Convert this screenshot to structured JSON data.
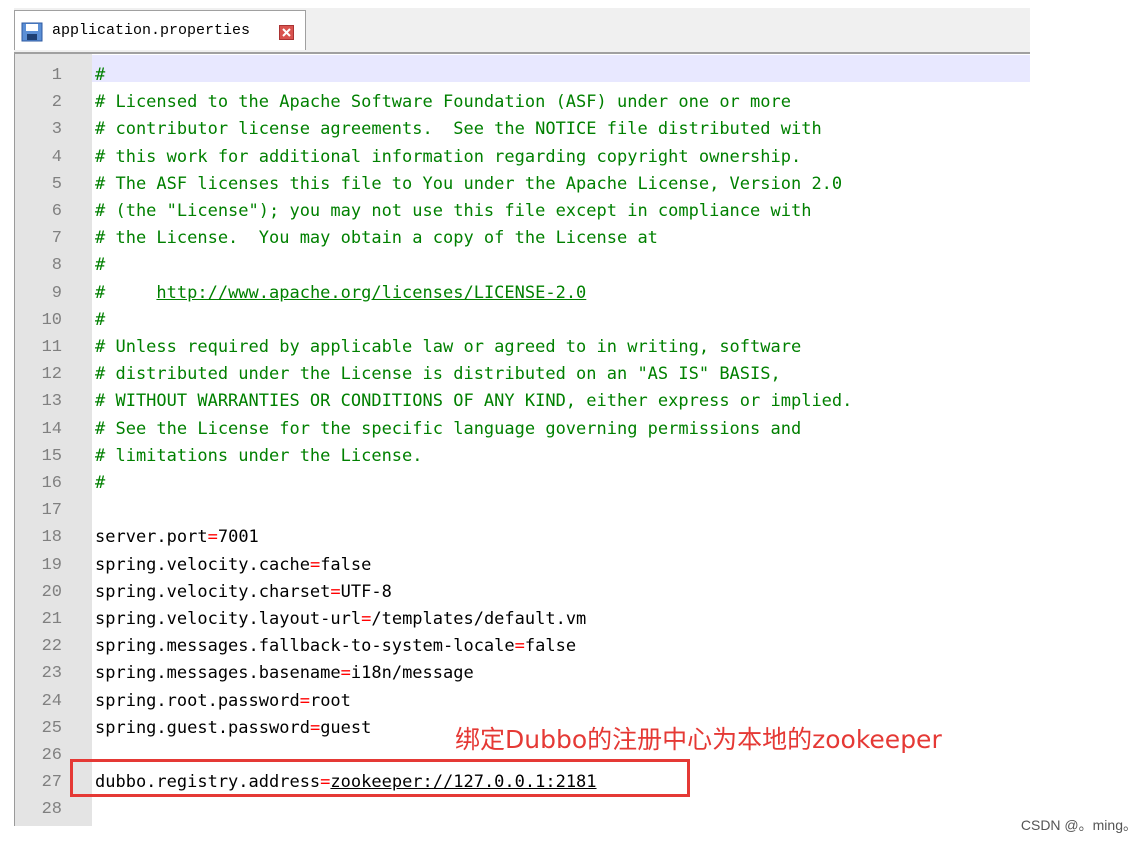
{
  "tab": {
    "filename": "application.properties",
    "icon": "file-save-icon",
    "close_icon": "close-icon"
  },
  "lines": [
    {
      "n": "1",
      "kind": "comment",
      "text": "#"
    },
    {
      "n": "2",
      "kind": "comment",
      "text": "# Licensed to the Apache Software Foundation (ASF) under one or more"
    },
    {
      "n": "3",
      "kind": "comment",
      "text": "# contributor license agreements.  See the NOTICE file distributed with"
    },
    {
      "n": "4",
      "kind": "comment",
      "text": "# this work for additional information regarding copyright ownership."
    },
    {
      "n": "5",
      "kind": "comment",
      "text": "# The ASF licenses this file to You under the Apache License, Version 2.0"
    },
    {
      "n": "6",
      "kind": "comment",
      "text": "# (the \"License\"); you may not use this file except in compliance with"
    },
    {
      "n": "7",
      "kind": "comment",
      "text": "# the License.  You may obtain a copy of the License at"
    },
    {
      "n": "8",
      "kind": "comment",
      "text": "#"
    },
    {
      "n": "9",
      "kind": "url",
      "prefix": "#     ",
      "text": "http://www.apache.org/licenses/LICENSE-2.0"
    },
    {
      "n": "10",
      "kind": "comment",
      "text": "#"
    },
    {
      "n": "11",
      "kind": "comment",
      "text": "# Unless required by applicable law or agreed to in writing, software"
    },
    {
      "n": "12",
      "kind": "comment",
      "text": "# distributed under the License is distributed on an \"AS IS\" BASIS,"
    },
    {
      "n": "13",
      "kind": "comment",
      "text": "# WITHOUT WARRANTIES OR CONDITIONS OF ANY KIND, either express or implied."
    },
    {
      "n": "14",
      "kind": "comment",
      "text": "# See the License for the specific language governing permissions and"
    },
    {
      "n": "15",
      "kind": "comment",
      "text": "# limitations under the License."
    },
    {
      "n": "16",
      "kind": "comment",
      "text": "#"
    },
    {
      "n": "17",
      "kind": "blank",
      "text": ""
    },
    {
      "n": "18",
      "kind": "prop",
      "key": "server.port",
      "value": "7001"
    },
    {
      "n": "19",
      "kind": "prop",
      "key": "spring.velocity.cache",
      "value": "false"
    },
    {
      "n": "20",
      "kind": "prop",
      "key": "spring.velocity.charset",
      "value": "UTF-8"
    },
    {
      "n": "21",
      "kind": "prop",
      "key": "spring.velocity.layout-url",
      "value": "/templates/default.vm"
    },
    {
      "n": "22",
      "kind": "prop",
      "key": "spring.messages.fallback-to-system-locale",
      "value": "false"
    },
    {
      "n": "23",
      "kind": "prop",
      "key": "spring.messages.basename",
      "value": "i18n/message"
    },
    {
      "n": "24",
      "kind": "prop",
      "key": "spring.root.password",
      "value": "root"
    },
    {
      "n": "25",
      "kind": "prop",
      "key": "spring.guest.password",
      "value": "guest"
    },
    {
      "n": "26",
      "kind": "blank",
      "text": ""
    },
    {
      "n": "27",
      "kind": "prop",
      "key": "dubbo.registry.address",
      "value": "zookeeper://127.0.0.1:2181",
      "link": true
    },
    {
      "n": "28",
      "kind": "blank",
      "text": ""
    }
  ],
  "annotation": "绑定Dubbo的注册中心为本地的zookeeper",
  "watermark": "CSDN @。ming。",
  "colors": {
    "comment": "#008000",
    "operator": "#ff0000",
    "annotation": "#e53935",
    "current_line": "#e8e8ff"
  }
}
